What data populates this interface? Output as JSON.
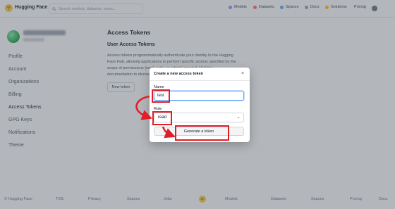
{
  "header": {
    "brand": "Hugging Face",
    "search_placeholder": "Search models, datasets, users...",
    "nav": [
      {
        "label": "Models",
        "color": "#a78bfa"
      },
      {
        "label": "Datasets",
        "color": "#f87171"
      },
      {
        "label": "Spaces",
        "color": "#60a5fa"
      },
      {
        "label": "Docs",
        "color": "#9ca3af"
      },
      {
        "label": "Solutions",
        "color": "#fbbf24"
      },
      {
        "label": "Pricing",
        "color": ""
      }
    ]
  },
  "sidebar": {
    "items": [
      {
        "label": "Profile"
      },
      {
        "label": "Account"
      },
      {
        "label": "Organizations"
      },
      {
        "label": "Billing"
      },
      {
        "label": "Access Tokens"
      },
      {
        "label": "GPG Keys"
      },
      {
        "label": "Notifications"
      },
      {
        "label": "Theme"
      }
    ]
  },
  "main": {
    "title": "Access Tokens",
    "subtitle": "User Access Tokens",
    "description_lines": [
      "Access tokens programmatically authenticate your identity to the Hugging",
      "Face Hub, allowing applications to perform specific actions specified by the",
      "scope of permissions (read, write, or admin) granted. Visit the",
      "documentation to discover how to use them."
    ],
    "new_token_label": "New token"
  },
  "modal": {
    "title": "Create a new access token",
    "close_symbol": "×",
    "name_label": "Name",
    "name_value": "test",
    "role_label": "Role",
    "role_value": "read",
    "generate_label": "Generate a token"
  },
  "footer": {
    "items": [
      "© Hugging Face",
      "TOS",
      "Privacy",
      "Spaces",
      "Jobs",
      "Models",
      "Datasets",
      "Spaces",
      "Pricing",
      "Docs"
    ]
  },
  "annotation": {
    "color": "#e11d26"
  }
}
